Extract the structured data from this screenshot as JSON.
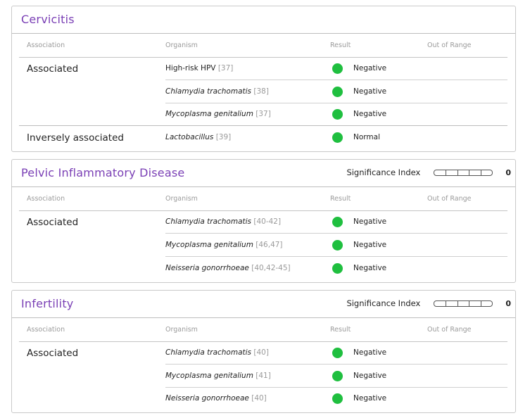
{
  "columns": {
    "association": "Association",
    "organism": "Organism",
    "result": "Result",
    "out_of_range": "Out of Range"
  },
  "colors": {
    "title": "#7a3fb5",
    "status_ok": "#1fbf3f"
  },
  "cards": [
    {
      "title": "Cervicitis",
      "groups": [
        {
          "association": "Associated",
          "rows": [
            {
              "organism": "High-risk HPV",
              "italic": false,
              "ref": "[37]",
              "result": "Negative"
            },
            {
              "organism": "Chlamydia trachomatis",
              "italic": true,
              "ref": "[38]",
              "result": "Negative"
            },
            {
              "organism": "Mycoplasma genitalium",
              "italic": true,
              "ref": "[37]",
              "result": "Negative"
            }
          ]
        },
        {
          "association": "Inversely associated",
          "rows": [
            {
              "organism": "Lactobacillus",
              "italic": true,
              "ref": "[39]",
              "result": "Normal"
            }
          ]
        }
      ]
    },
    {
      "title": "Pelvic Inflammatory Disease",
      "significance_label": "Significance Index",
      "significance_value": "0",
      "significance_level": 0,
      "groups": [
        {
          "association": "Associated",
          "rows": [
            {
              "organism": "Chlamydia trachomatis",
              "italic": true,
              "ref": "[40-42]",
              "result": "Negative"
            },
            {
              "organism": "Mycoplasma genitalium",
              "italic": true,
              "ref": "[46,47]",
              "result": "Negative"
            },
            {
              "organism": "Neisseria gonorrhoeae",
              "italic": true,
              "ref": "[40,42-45]",
              "result": "Negative"
            }
          ]
        }
      ]
    },
    {
      "title": "Infertility",
      "significance_label": "Significance Index",
      "significance_value": "0",
      "significance_level": 0,
      "groups": [
        {
          "association": "Associated",
          "rows": [
            {
              "organism": "Chlamydia trachomatis",
              "italic": true,
              "ref": "[40]",
              "result": "Negative"
            },
            {
              "organism": "Mycoplasma genitalium",
              "italic": true,
              "ref": "[41]",
              "result": "Negative"
            },
            {
              "organism": "Neisseria gonorrhoeae",
              "italic": true,
              "ref": "[40]",
              "result": "Negative"
            }
          ]
        }
      ]
    }
  ]
}
